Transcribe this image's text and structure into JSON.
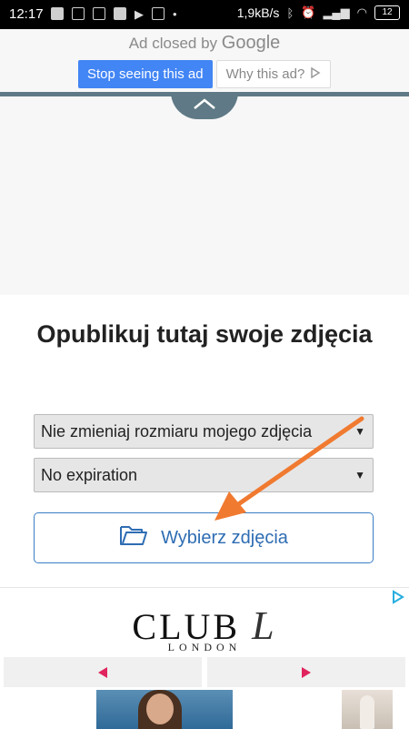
{
  "status_bar": {
    "time": "12:17",
    "speed": "1,9kB/s",
    "battery": "12"
  },
  "ad_closed": {
    "prefix": "Ad closed by",
    "brand": "Google",
    "stop_label": "Stop seeing this ad",
    "why_label": "Why this ad?"
  },
  "main": {
    "heading": "Opublikuj tutaj swoje zdjęcia",
    "resize_select": "Nie zmieniaj rozmiaru mojego zdjęcia",
    "expiration_select": "No expiration",
    "choose_button": "Wybierz zdjęcia",
    "accent_color": "#2e6db3",
    "arrow_color": "#f07a30"
  },
  "bottom_ad": {
    "brand": "CLUB",
    "brand_script": "L",
    "sub": "LONDON",
    "nav_color": "#e0245e"
  }
}
